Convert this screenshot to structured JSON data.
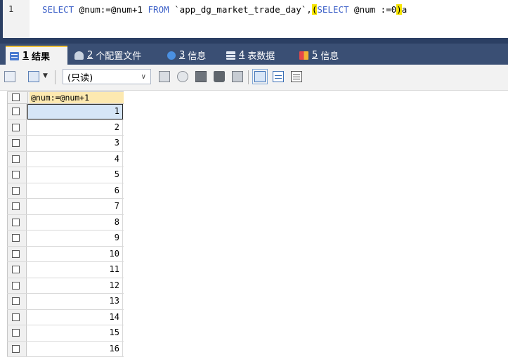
{
  "editor": {
    "line_number": "1",
    "code": {
      "kw_select1": "SELECT",
      "part1": " @num:=@num+1 ",
      "kw_from": "FROM",
      "part2": " `app_dg_market_trade_day`,",
      "paren_open": "(",
      "kw_select2": "SELECT",
      "part3": " @num :=0",
      "paren_close": ")",
      "part4": "a"
    }
  },
  "tabs": [
    {
      "num": "1",
      "label": "结果",
      "icon": "results-grid-icon"
    },
    {
      "num": "2",
      "label": "个配置文件",
      "icon": "profile-icon"
    },
    {
      "num": "3",
      "label": "信息",
      "icon": "info-icon"
    },
    {
      "num": "4",
      "label": "表数据",
      "icon": "table-data-icon"
    },
    {
      "num": "5",
      "label": "信息",
      "icon": "info-puzzle-icon"
    }
  ],
  "toolbar": {
    "mode_select": "(只读)"
  },
  "grid": {
    "column": "@num:=@num+1",
    "rows": [
      "1",
      "2",
      "3",
      "4",
      "5",
      "6",
      "7",
      "8",
      "9",
      "10",
      "11",
      "12",
      "13",
      "14",
      "15",
      "16"
    ]
  },
  "colors": {
    "navy": "#2b3f63",
    "tab_bar": "#3a4f74",
    "highlight": "#f7e500",
    "header_cell": "#fde9b0",
    "selected_cell": "#d6e6f7"
  }
}
